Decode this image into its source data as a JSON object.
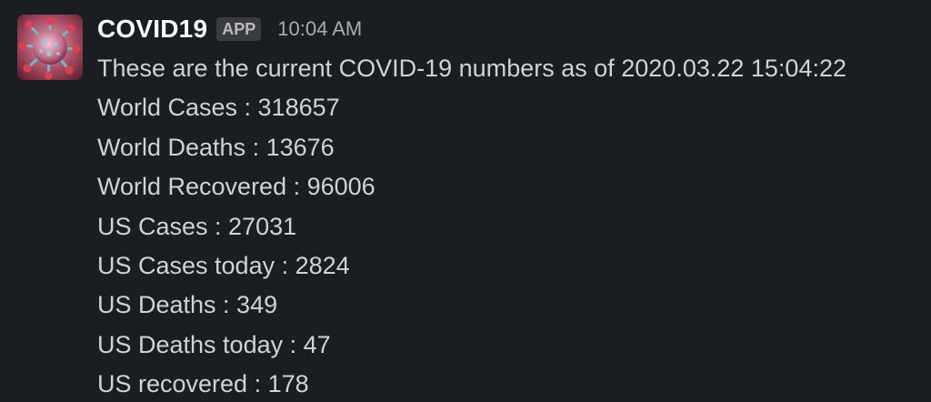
{
  "message": {
    "sender": "COVID19",
    "badge": "APP",
    "timestamp": "10:04 AM",
    "intro": "These are the current COVID-19 numbers as of 2020.03.22 15:04:22",
    "stats": [
      "World Cases : 318657",
      "World Deaths : 13676",
      "World Recovered : 96006",
      "US Cases : 27031",
      "US Cases today : 2824",
      "US Deaths : 349",
      "US Deaths today : 47",
      "US recovered : 178"
    ]
  },
  "colors": {
    "background": "#1a1d21",
    "text": "#d1d2d3",
    "sender": "#ffffff",
    "badge_bg": "#3a3c40",
    "timestamp": "#aaabad"
  },
  "icons": {
    "avatar": "coronavirus-avatar-icon"
  }
}
